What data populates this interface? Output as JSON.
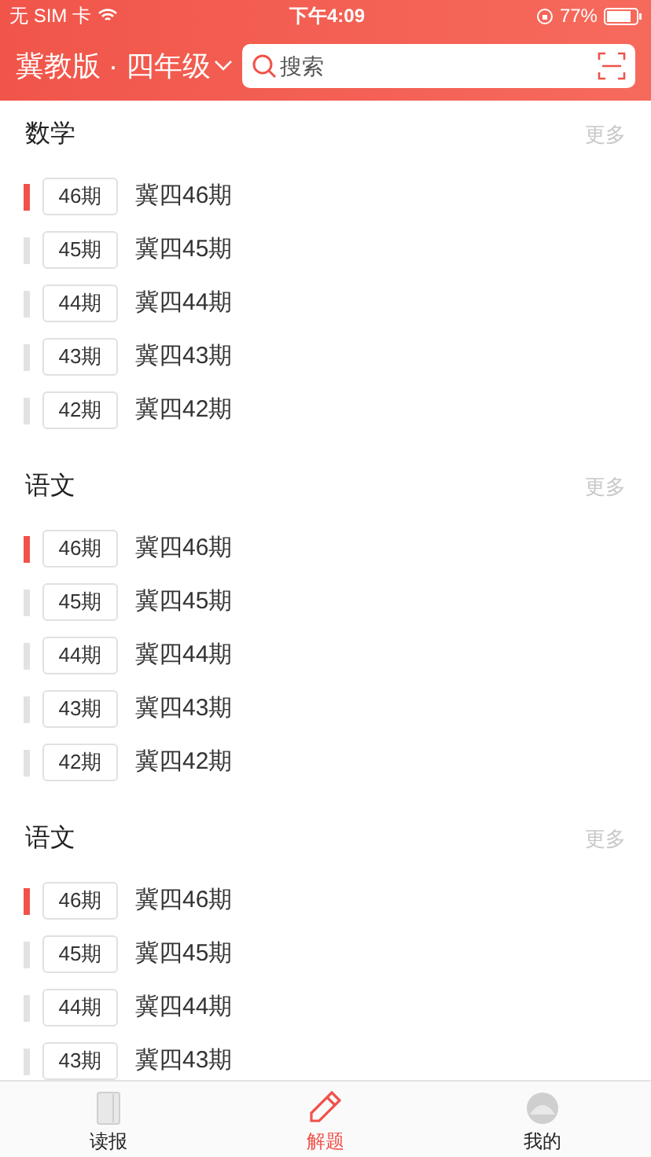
{
  "status_bar": {
    "carrier": "无 SIM 卡",
    "time": "下午4:09",
    "battery": "77%"
  },
  "header": {
    "title": "冀教版 · 四年级",
    "search": {
      "placeholder": "搜索"
    }
  },
  "sections": [
    {
      "title": "数学",
      "more": "更多",
      "items": [
        {
          "badge": "46期",
          "label": "冀四46期",
          "selected": true
        },
        {
          "badge": "45期",
          "label": "冀四45期",
          "selected": false
        },
        {
          "badge": "44期",
          "label": "冀四44期",
          "selected": false
        },
        {
          "badge": "43期",
          "label": "冀四43期",
          "selected": false
        },
        {
          "badge": "42期",
          "label": "冀四42期",
          "selected": false
        }
      ]
    },
    {
      "title": "语文",
      "more": "更多",
      "items": [
        {
          "badge": "46期",
          "label": "冀四46期",
          "selected": true
        },
        {
          "badge": "45期",
          "label": "冀四45期",
          "selected": false
        },
        {
          "badge": "44期",
          "label": "冀四44期",
          "selected": false
        },
        {
          "badge": "43期",
          "label": "冀四43期",
          "selected": false
        },
        {
          "badge": "42期",
          "label": "冀四42期",
          "selected": false
        }
      ]
    },
    {
      "title": "语文",
      "more": "更多",
      "items": [
        {
          "badge": "46期",
          "label": "冀四46期",
          "selected": true
        },
        {
          "badge": "45期",
          "label": "冀四45期",
          "selected": false
        },
        {
          "badge": "44期",
          "label": "冀四44期",
          "selected": false
        },
        {
          "badge": "43期",
          "label": "冀四43期",
          "selected": false
        }
      ]
    }
  ],
  "tab_bar": [
    {
      "kind": "book",
      "label": "读报",
      "selected": false
    },
    {
      "kind": "pencil",
      "label": "解题",
      "selected": true
    },
    {
      "kind": "avatar",
      "label": "我的",
      "selected": false
    }
  ]
}
